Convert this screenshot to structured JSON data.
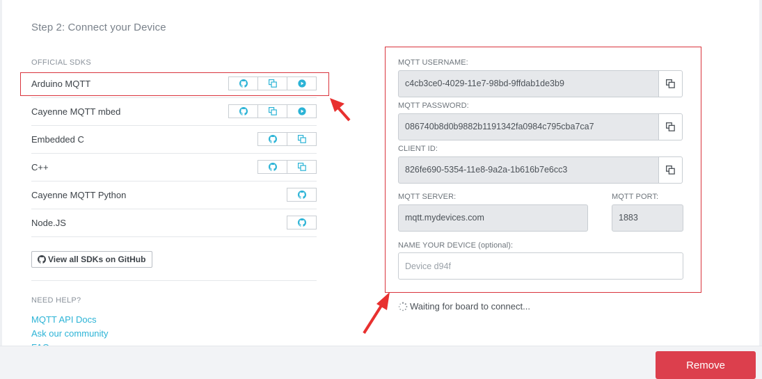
{
  "step_title": "Step 2: Connect your Device",
  "official_sdks_label": "OFFICIAL SDKS",
  "sdks": [
    {
      "name": "Arduino MQTT"
    },
    {
      "name": "Cayenne MQTT mbed"
    },
    {
      "name": "Embedded C"
    },
    {
      "name": "C++"
    },
    {
      "name": "Cayenne MQTT Python"
    },
    {
      "name": "Node.JS"
    }
  ],
  "view_all_label": "View all SDKs on GitHub",
  "need_help_label": "NEED HELP?",
  "help_links": [
    "MQTT API Docs",
    "Ask our community",
    "FAQ"
  ],
  "form": {
    "username_label": "MQTT USERNAME:",
    "username": "c4cb3ce0-4029-11e7-98bd-9ffdab1de3b9",
    "password_label": "MQTT PASSWORD:",
    "password": "086740b8d0b9882b1191342fa0984c795cba7ca7",
    "client_id_label": "CLIENT ID:",
    "client_id": "826fe690-5354-11e8-9a2a-1b616b7e6cc3",
    "server_label": "MQTT SERVER:",
    "server": "mqtt.mydevices.com",
    "port_label": "MQTT PORT:",
    "port": "1883",
    "device_name_label": "NAME YOUR DEVICE (optional):",
    "device_name_placeholder": "Device d94f"
  },
  "waiting_text": "Waiting for board to connect...",
  "remove_label": "Remove",
  "colors": {
    "accent": "#2bb3d6",
    "highlight": "#d9333c",
    "remove": "#dc3f4d"
  }
}
